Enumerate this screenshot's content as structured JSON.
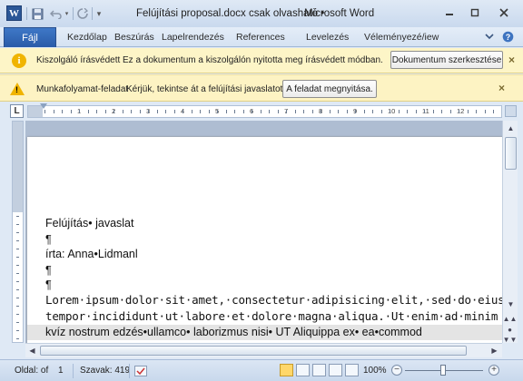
{
  "titlebar": {
    "app_icon_letter": "W",
    "document_title": "Felújítási proposal.docx csak olvasható •",
    "app_name": "Microsoft Word",
    "icons": [
      "word-icon",
      "save-icon",
      "undo-icon",
      "redo-icon",
      "customize-qat-icon",
      "minimize-icon",
      "maximize-icon",
      "close-icon"
    ]
  },
  "ribbon": {
    "file_tab": "Fájl",
    "tabs": [
      "Kezdőlap",
      "Beszúrás",
      "Lapelrendezés",
      "References",
      "Levelezés",
      "Véleményezé/iew"
    ]
  },
  "messagebar1": {
    "label": "Kiszolgáló írásvédett",
    "text": "Ez a dokumentum a kiszolgálón nyitotta meg írásvédett módban.",
    "button": "Dokumentum szerkesztése",
    "close": "×"
  },
  "messagebar2": {
    "label": "Munkafolyamat-feladat",
    "text": "Kérjük, tekintse át a felújítási javaslatot",
    "button": "A feladat megnyitása.",
    "close": "×"
  },
  "ruler": {
    "corner": "L",
    "numbers": [
      "1",
      "2",
      "3",
      "4",
      "5",
      "6",
      "7",
      "8",
      "9",
      "10",
      "11",
      "12"
    ]
  },
  "document": {
    "lines": [
      "Felújítás• javaslat",
      "¶",
      "írta: Anna•Lidmanl",
      "¶",
      "¶"
    ],
    "lorem1": "Lorem·ipsum·dolor·sit·amet,·consectetur·adipisicing·elit,·sed·do·eiusmod",
    "lorem2": "tempor·incididunt·ut·labore·et·dolore·magna·aliqua.·Ut·enim·ad·minim",
    "highlighted_line": "kvíz nostrum edzés•ullamco• laborizmus nisi• UT Aliquippa ex• ea•commod"
  },
  "statusbar": {
    "page": "Oldal: of",
    "page_num": "1",
    "words": "Szavak: 419",
    "zoom": "100%",
    "zoom_minus": "−",
    "zoom_plus": "+",
    "zoom_level_fraction": 0.45
  }
}
